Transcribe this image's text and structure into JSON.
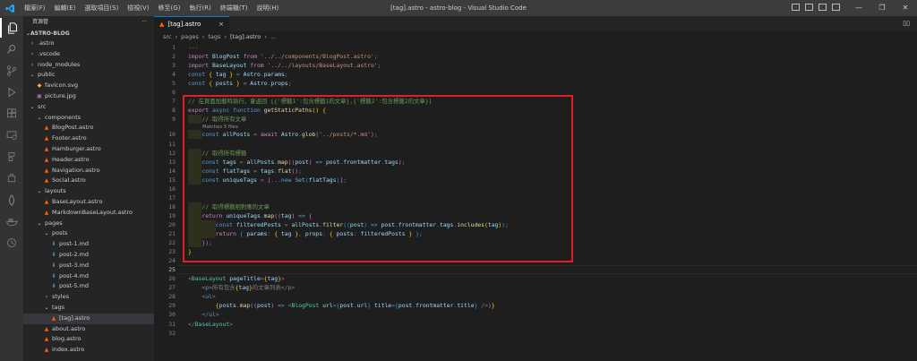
{
  "titlebar": {
    "menu": [
      "檔案(F)",
      "編輯(E)",
      "選取項目(S)",
      "檢視(V)",
      "移至(G)",
      "執行(R)",
      "終端機(T)",
      "說明(H)"
    ],
    "window_title": "[tag].astro - astro-blog - Visual Studio Code"
  },
  "sidebar": {
    "header": "資源管",
    "header_more": "···",
    "project": "ASTRO-BLOG",
    "tree": [
      {
        "label": ".astro",
        "type": "folder",
        "open": false,
        "depth": 0
      },
      {
        "label": ".vscode",
        "type": "folder",
        "open": false,
        "depth": 0
      },
      {
        "label": "node_modules",
        "type": "folder",
        "open": false,
        "depth": 0
      },
      {
        "label": "public",
        "type": "folder",
        "open": true,
        "depth": 0
      },
      {
        "label": "favicon.svg",
        "type": "svg",
        "depth": 1
      },
      {
        "label": "picture.jpg",
        "type": "img",
        "depth": 1
      },
      {
        "label": "src",
        "type": "folder",
        "open": true,
        "depth": 0
      },
      {
        "label": "components",
        "type": "folder",
        "open": true,
        "depth": 1
      },
      {
        "label": "BlogPost.astro",
        "type": "astro",
        "depth": 2
      },
      {
        "label": "Footer.astro",
        "type": "astro",
        "depth": 2
      },
      {
        "label": "Hamburger.astro",
        "type": "astro",
        "depth": 2
      },
      {
        "label": "Header.astro",
        "type": "astro",
        "depth": 2
      },
      {
        "label": "Navigation.astro",
        "type": "astro",
        "depth": 2
      },
      {
        "label": "Social.astro",
        "type": "astro",
        "depth": 2
      },
      {
        "label": "layouts",
        "type": "folder",
        "open": true,
        "depth": 1
      },
      {
        "label": "BaseLayout.astro",
        "type": "astro",
        "depth": 2
      },
      {
        "label": "MarkdownBaseLayout.astro",
        "type": "astro",
        "depth": 2
      },
      {
        "label": "pages",
        "type": "folder",
        "open": true,
        "depth": 1
      },
      {
        "label": "posts",
        "type": "folder",
        "open": true,
        "depth": 2
      },
      {
        "label": "post-1.md",
        "type": "md",
        "depth": 3
      },
      {
        "label": "post-2.md",
        "type": "md",
        "depth": 3
      },
      {
        "label": "post-3.md",
        "type": "md",
        "depth": 3
      },
      {
        "label": "post-4.md",
        "type": "md",
        "depth": 3
      },
      {
        "label": "post-5.md",
        "type": "md",
        "depth": 3
      },
      {
        "label": "styles",
        "type": "folder",
        "open": false,
        "depth": 2
      },
      {
        "label": "tags",
        "type": "folder",
        "open": true,
        "depth": 2
      },
      {
        "label": "[tag].astro",
        "type": "astro",
        "depth": 3,
        "selected": true
      },
      {
        "label": "about.astro",
        "type": "astro",
        "depth": 2
      },
      {
        "label": "blog.astro",
        "type": "astro",
        "depth": 2
      },
      {
        "label": "index.astro",
        "type": "astro",
        "depth": 2
      }
    ]
  },
  "tab": {
    "label": "[tag].astro",
    "close": "×"
  },
  "breadcrumb": [
    "src",
    "pages",
    "tags",
    "[tag].astro",
    "..."
  ],
  "editor": {
    "line_numbers": [
      "1",
      "2",
      "3",
      "4",
      "5",
      "6",
      "7",
      "8",
      "9",
      "10",
      "11",
      "12",
      "13",
      "14",
      "15",
      "16",
      "17",
      "18",
      "19",
      "20",
      "21",
      "22",
      "23",
      "24",
      "25",
      "26",
      "27",
      "28",
      "29",
      "30",
      "31",
      "32"
    ],
    "codelens": "Matches 5 files",
    "lines": [
      [
        [
          "pn",
          "---"
        ]
      ],
      [
        [
          "kw",
          "import "
        ],
        [
          "var",
          "BlogPost"
        ],
        [
          "kw",
          " from "
        ],
        [
          "str",
          "'../../components/BlogPost.astro'"
        ],
        [
          "pn",
          ";"
        ]
      ],
      [
        [
          "kw",
          "import "
        ],
        [
          "var",
          "BaseLayout"
        ],
        [
          "kw",
          " from "
        ],
        [
          "str",
          "'../../layouts/BaseLayout.astro'"
        ],
        [
          "pn",
          ";"
        ]
      ],
      [
        [
          "kb",
          "const "
        ],
        [
          "br1",
          "{ "
        ],
        [
          "var",
          "tag"
        ],
        [
          "br1",
          " }"
        ],
        [
          "pn",
          " = "
        ],
        [
          "var",
          "Astro"
        ],
        [
          "pn",
          "."
        ],
        [
          "var",
          "params"
        ],
        [
          "pn",
          ";"
        ]
      ],
      [
        [
          "kb",
          "const "
        ],
        [
          "br1",
          "{ "
        ],
        [
          "var",
          "posts"
        ],
        [
          "br1",
          " }"
        ],
        [
          "pn",
          " = "
        ],
        [
          "var",
          "Astro"
        ],
        [
          "pn",
          "."
        ],
        [
          "var",
          "props"
        ],
        [
          "pn",
          ";"
        ]
      ],
      [],
      [
        [
          "cm",
          "// 在頁面加載時執行，會返回 [{'標籤1':包含標籤1的文章},{'標籤2':包含標籤2的文章}]"
        ]
      ],
      [
        [
          "kw",
          "export "
        ],
        [
          "kb",
          "async function "
        ],
        [
          "fn",
          "getStaticPaths"
        ],
        [
          "br1",
          "() {"
        ]
      ],
      [
        [
          "cm",
          "    // 取得所有文章"
        ]
      ],
      [
        [
          "kb",
          "    const "
        ],
        [
          "var",
          "allPosts"
        ],
        [
          "pn",
          " = "
        ],
        [
          "kw",
          "await "
        ],
        [
          "var",
          "Astro"
        ],
        [
          "pn",
          "."
        ],
        [
          "fn",
          "glob"
        ],
        [
          "br2",
          "("
        ],
        [
          "str",
          "'../posts/*.md'"
        ],
        [
          "br2",
          ")"
        ],
        [
          "pn",
          ";"
        ]
      ],
      [],
      [
        [
          "cm",
          "    // 取得所有標籤"
        ]
      ],
      [
        [
          "kb",
          "    const "
        ],
        [
          "var",
          "tags"
        ],
        [
          "pn",
          " = "
        ],
        [
          "var",
          "allPosts"
        ],
        [
          "pn",
          "."
        ],
        [
          "fn",
          "map"
        ],
        [
          "br2",
          "(("
        ],
        [
          "var",
          "post"
        ],
        [
          "br2",
          ")"
        ],
        [
          "kb",
          " => "
        ],
        [
          "var",
          "post"
        ],
        [
          "pn",
          "."
        ],
        [
          "var",
          "frontmatter"
        ],
        [
          "pn",
          "."
        ],
        [
          "var",
          "tags"
        ],
        [
          "br2",
          ")"
        ],
        [
          "pn",
          ";"
        ]
      ],
      [
        [
          "kb",
          "    const "
        ],
        [
          "var",
          "flatTags"
        ],
        [
          "pn",
          " = "
        ],
        [
          "var",
          "tags"
        ],
        [
          "pn",
          "."
        ],
        [
          "fn",
          "flat"
        ],
        [
          "br2",
          "()"
        ],
        [
          "pn",
          ";"
        ]
      ],
      [
        [
          "kb",
          "    const "
        ],
        [
          "var",
          "uniqueTags"
        ],
        [
          "pn",
          " = "
        ],
        [
          "br2",
          "["
        ],
        [
          "pn",
          "..."
        ],
        [
          "kb",
          "new "
        ],
        [
          "ty",
          "Set"
        ],
        [
          "br3",
          "("
        ],
        [
          "var",
          "flatTags"
        ],
        [
          "br3",
          ")"
        ],
        [
          "br2",
          "]"
        ],
        [
          "pn",
          ";"
        ]
      ],
      [],
      [],
      [
        [
          "cm",
          "    // 取得標籤相對應的文章"
        ]
      ],
      [
        [
          "kw",
          "    return "
        ],
        [
          "var",
          "uniqueTags"
        ],
        [
          "pn",
          "."
        ],
        [
          "fn",
          "map"
        ],
        [
          "br2",
          "(("
        ],
        [
          "var",
          "tag"
        ],
        [
          "br2",
          ")"
        ],
        [
          "kb",
          " => "
        ],
        [
          "br2",
          "{"
        ]
      ],
      [
        [
          "kb",
          "        const "
        ],
        [
          "var",
          "filteredPosts"
        ],
        [
          "pn",
          " = "
        ],
        [
          "var",
          "allPosts"
        ],
        [
          "pn",
          "."
        ],
        [
          "fn",
          "filter"
        ],
        [
          "br3",
          "(("
        ],
        [
          "var",
          "post"
        ],
        [
          "br3",
          ")"
        ],
        [
          "kb",
          " => "
        ],
        [
          "var",
          "post"
        ],
        [
          "pn",
          "."
        ],
        [
          "var",
          "frontmatter"
        ],
        [
          "pn",
          "."
        ],
        [
          "var",
          "tags"
        ],
        [
          "pn",
          "."
        ],
        [
          "fn",
          "includes"
        ],
        [
          "br1",
          "("
        ],
        [
          "var",
          "tag"
        ],
        [
          "br1",
          ")"
        ],
        [
          "br3",
          ")"
        ],
        [
          "pn",
          ";"
        ]
      ],
      [
        [
          "kw",
          "        return "
        ],
        [
          "br3",
          "{ "
        ],
        [
          "var",
          "params"
        ],
        [
          "pn",
          ": "
        ],
        [
          "br1",
          "{ "
        ],
        [
          "var",
          "tag"
        ],
        [
          "br1",
          " }"
        ],
        [
          "pn",
          ", "
        ],
        [
          "var",
          "props"
        ],
        [
          "pn",
          ": "
        ],
        [
          "br1",
          "{ "
        ],
        [
          "var",
          "posts"
        ],
        [
          "pn",
          ": "
        ],
        [
          "var",
          "filteredPosts"
        ],
        [
          "br1",
          " }"
        ],
        [
          "br3",
          " }"
        ],
        [
          "pn",
          ";"
        ]
      ],
      [
        [
          "br2",
          "    })"
        ],
        [
          "pn",
          ";"
        ]
      ],
      [
        [
          "br1",
          "}"
        ]
      ],
      [
        [
          "pn",
          "---"
        ]
      ],
      [],
      [
        [
          "pn",
          "<"
        ],
        [
          "ty",
          "BaseLayout "
        ],
        [
          "var",
          "pageTitle"
        ],
        [
          "pn",
          "="
        ],
        [
          "br1",
          "{"
        ],
        [
          "var",
          "tag"
        ],
        [
          "br1",
          "}"
        ],
        [
          "pn",
          ">"
        ]
      ],
      [
        [
          "pn",
          "    <"
        ],
        [
          "kb",
          "p"
        ],
        [
          "pn",
          ">"
        ],
        [
          "pn",
          "所有包含"
        ],
        [
          "br1",
          "{"
        ],
        [
          "var",
          "tag"
        ],
        [
          "br1",
          "}"
        ],
        [
          "pn",
          "的文章列表"
        ],
        [
          "pn",
          "</"
        ],
        [
          "kb",
          "p"
        ],
        [
          "pn",
          ">"
        ]
      ],
      [
        [
          "pn",
          "    <"
        ],
        [
          "kb",
          "ul"
        ],
        [
          "pn",
          ">"
        ]
      ],
      [
        [
          "br1",
          "        {"
        ],
        [
          "var",
          "posts"
        ],
        [
          "pn",
          "."
        ],
        [
          "fn",
          "map"
        ],
        [
          "br2",
          "(("
        ],
        [
          "var",
          "post"
        ],
        [
          "br2",
          ")"
        ],
        [
          "kb",
          " => "
        ],
        [
          "pn",
          "<"
        ],
        [
          "ty",
          "BlogPost "
        ],
        [
          "var",
          "url"
        ],
        [
          "pn",
          "="
        ],
        [
          "br3",
          "{"
        ],
        [
          "var",
          "post"
        ],
        [
          "pn",
          "."
        ],
        [
          "var",
          "url"
        ],
        [
          "br3",
          "}"
        ],
        [
          "var",
          " title"
        ],
        [
          "pn",
          "="
        ],
        [
          "br3",
          "{"
        ],
        [
          "var",
          "post"
        ],
        [
          "pn",
          "."
        ],
        [
          "var",
          "frontmatter"
        ],
        [
          "pn",
          "."
        ],
        [
          "var",
          "title"
        ],
        [
          "br3",
          "}"
        ],
        [
          "pn",
          " />"
        ],
        [
          "br2",
          ")"
        ],
        [
          "br1",
          "}"
        ]
      ],
      [
        [
          "pn",
          "    </"
        ],
        [
          "kb",
          "ul"
        ],
        [
          "pn",
          ">"
        ]
      ],
      [
        [
          "pn",
          "</"
        ],
        [
          "ty",
          "BaseLayout"
        ],
        [
          "pn",
          ">"
        ]
      ],
      []
    ]
  },
  "colors": {
    "highlight_box": "#e01e2c",
    "accent": "#007acc"
  }
}
